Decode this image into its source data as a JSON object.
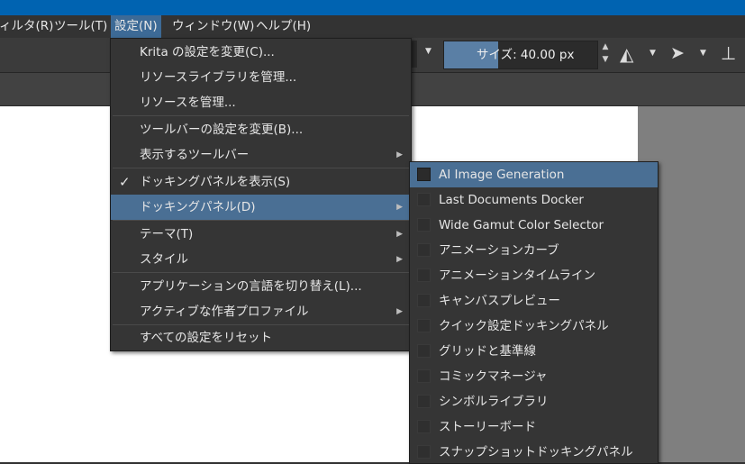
{
  "menubar": {
    "items": [
      {
        "label": "ィルタ(R)"
      },
      {
        "label": "ツール(T)"
      },
      {
        "label": "設定(N)"
      },
      {
        "label": "ウィンドウ(W)"
      },
      {
        "label": "ヘルプ(H)"
      }
    ]
  },
  "toolbar": {
    "size_label": "サイズ: 40.00 px",
    "size_fraction": 0.35
  },
  "settings_menu": {
    "items": [
      {
        "label": "Krita の設定を変更(C)..."
      },
      {
        "label": "リソースライブラリを管理..."
      },
      {
        "label": "リソースを管理..."
      },
      {
        "label": "ツールバーの設定を変更(B)..."
      },
      {
        "label": "表示するツールバー"
      },
      {
        "label": "ドッキングパネルを表示(S)"
      },
      {
        "label": "ドッキングパネル(D)"
      },
      {
        "label": "テーマ(T)"
      },
      {
        "label": "スタイル"
      },
      {
        "label": "アプリケーションの言語を切り替え(L)..."
      },
      {
        "label": "アクティブな作者プロファイル"
      },
      {
        "label": "すべての設定をリセット"
      }
    ]
  },
  "docker_submenu": {
    "items": [
      {
        "label": "AI Image Generation"
      },
      {
        "label": "Last Documents Docker"
      },
      {
        "label": "Wide Gamut Color Selector"
      },
      {
        "label": "アニメーションカーブ"
      },
      {
        "label": "アニメーションタイムライン"
      },
      {
        "label": "キャンバスプレビュー"
      },
      {
        "label": "クイック設定ドッキングパネル"
      },
      {
        "label": "グリッドと基準線"
      },
      {
        "label": "コミックマネージャ"
      },
      {
        "label": "シンボルライブラリ"
      },
      {
        "label": "ストーリーボード"
      },
      {
        "label": "スナップショットドッキングパネル"
      }
    ]
  }
}
